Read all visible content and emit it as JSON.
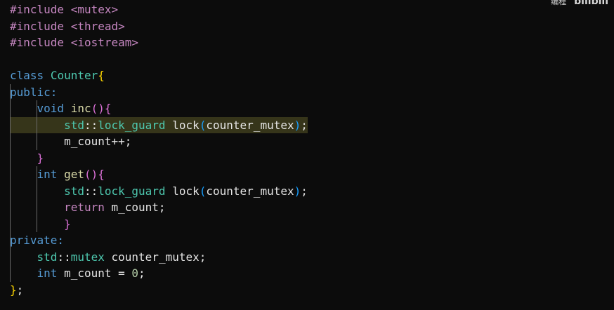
{
  "editor": {
    "language": "cpp",
    "current_line": 8,
    "watermark": {
      "text": "编程",
      "logo": "bilibili"
    },
    "lines": [
      [
        {
          "t": "#include <mutex>",
          "c": "pp"
        }
      ],
      [
        {
          "t": "#include <thread>",
          "c": "pp"
        }
      ],
      [
        {
          "t": "#include <iostream>",
          "c": "pp"
        }
      ],
      [],
      [
        {
          "t": "class",
          "c": "kw"
        },
        {
          "t": " ",
          "c": "pl"
        },
        {
          "t": "Counter",
          "c": "ty"
        },
        {
          "t": "{",
          "c": "bg"
        }
      ],
      [
        {
          "t": "public:",
          "c": "kw"
        }
      ],
      [
        {
          "t": "    ",
          "c": "pl"
        },
        {
          "t": "void",
          "c": "kw"
        },
        {
          "t": " ",
          "c": "pl"
        },
        {
          "t": "inc",
          "c": "fn"
        },
        {
          "t": "()",
          "c": "bp"
        },
        {
          "t": "{",
          "c": "bp"
        }
      ],
      [
        {
          "t": "        ",
          "c": "pl"
        },
        {
          "t": "std",
          "c": "ty"
        },
        {
          "t": "::",
          "c": "pl"
        },
        {
          "t": "lock_guard",
          "c": "ty"
        },
        {
          "t": " lock",
          "c": "pl"
        },
        {
          "t": "(",
          "c": "bb"
        },
        {
          "t": "counter_mutex",
          "c": "pl"
        },
        {
          "t": ")",
          "c": "bb"
        },
        {
          "t": ";",
          "c": "pl"
        }
      ],
      [
        {
          "t": "        m_count++;",
          "c": "pl"
        }
      ],
      [
        {
          "t": "    ",
          "c": "pl"
        },
        {
          "t": "}",
          "c": "bp"
        }
      ],
      [
        {
          "t": "    ",
          "c": "pl"
        },
        {
          "t": "int",
          "c": "kw"
        },
        {
          "t": " ",
          "c": "pl"
        },
        {
          "t": "get",
          "c": "fn"
        },
        {
          "t": "()",
          "c": "bp"
        },
        {
          "t": "{",
          "c": "bp"
        }
      ],
      [
        {
          "t": "        ",
          "c": "pl"
        },
        {
          "t": "std",
          "c": "ty"
        },
        {
          "t": "::",
          "c": "pl"
        },
        {
          "t": "lock_guard",
          "c": "ty"
        },
        {
          "t": " lock",
          "c": "pl"
        },
        {
          "t": "(",
          "c": "bb"
        },
        {
          "t": "counter_mutex",
          "c": "pl"
        },
        {
          "t": ")",
          "c": "bb"
        },
        {
          "t": ";",
          "c": "pl"
        }
      ],
      [
        {
          "t": "        ",
          "c": "pl"
        },
        {
          "t": "return",
          "c": "pp"
        },
        {
          "t": " m_count;",
          "c": "pl"
        }
      ],
      [
        {
          "t": "        ",
          "c": "pl"
        },
        {
          "t": "}",
          "c": "bp"
        }
      ],
      [
        {
          "t": "private:",
          "c": "kw"
        }
      ],
      [
        {
          "t": "    ",
          "c": "pl"
        },
        {
          "t": "std",
          "c": "ty"
        },
        {
          "t": "::",
          "c": "pl"
        },
        {
          "t": "mutex",
          "c": "ty"
        },
        {
          "t": " counter_mutex;",
          "c": "pl"
        }
      ],
      [
        {
          "t": "    ",
          "c": "pl"
        },
        {
          "t": "int",
          "c": "kw"
        },
        {
          "t": " m_count = ",
          "c": "pl"
        },
        {
          "t": "0",
          "c": "num"
        },
        {
          "t": ";",
          "c": "pl"
        }
      ],
      [
        {
          "t": "}",
          "c": "bg"
        },
        {
          "t": ";",
          "c": "pl"
        }
      ]
    ],
    "colors": {
      "background": "#0c0c0c",
      "current_line_highlight": "#36351a",
      "preprocessor": "#c586c0",
      "keyword": "#569cd6",
      "type": "#4ec9b0",
      "function": "#dcdcaa",
      "plain": "#e6e6e6",
      "number": "#b5cea8",
      "bracket_gold": "#ffd700",
      "bracket_purple": "#da70d6",
      "bracket_blue": "#179fff",
      "indent_guide": "#6a6a6a"
    }
  }
}
